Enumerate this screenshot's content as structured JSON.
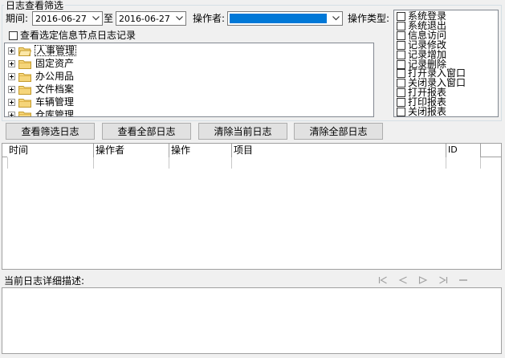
{
  "filter": {
    "group_title": "日志查看筛选",
    "period_label": "期间:",
    "date_from": "2016-06-27",
    "to_label": "至",
    "date_to": "2016-06-27",
    "operator_label": "操作者:",
    "operator_value": "",
    "type_label": "操作类型:",
    "node_log_checkbox_label": "查看选定信息节点日志记录",
    "node_log_checked": false
  },
  "tree": {
    "items": [
      {
        "label": "人事管理",
        "selected": true
      },
      {
        "label": "固定资产"
      },
      {
        "label": "办公用品"
      },
      {
        "label": "文件档案"
      },
      {
        "label": "车辆管理"
      },
      {
        "label": "仓库管理"
      }
    ]
  },
  "operation_types": [
    {
      "label": "系统登录",
      "checked": false
    },
    {
      "label": "系统退出",
      "checked": false
    },
    {
      "label": "信息访问",
      "checked": false
    },
    {
      "label": "记录修改",
      "checked": false
    },
    {
      "label": "记录增加",
      "checked": false
    },
    {
      "label": "记录删除",
      "checked": false
    },
    {
      "label": "打开录入窗口",
      "checked": false
    },
    {
      "label": "关闭录入窗口",
      "checked": false
    },
    {
      "label": "打开报表",
      "checked": false
    },
    {
      "label": "打印报表",
      "checked": false
    },
    {
      "label": "关闭报表",
      "checked": false
    }
  ],
  "buttons": {
    "view_filtered": "查看筛选日志",
    "view_all": "查看全部日志",
    "clear_current": "清除当前日志",
    "clear_all": "清除全部日志"
  },
  "log_table": {
    "columns": [
      "时间",
      "操作者",
      "操作",
      "项目",
      "ID"
    ],
    "rows": []
  },
  "detail": {
    "label": "当前日志详细描述:",
    "text": ""
  },
  "nav_icons": [
    "first-icon",
    "prev-icon",
    "next-icon",
    "last-icon",
    "clear-icon"
  ],
  "colors": {
    "selection": "#0078d7",
    "window_bg": "#f0f0f0"
  }
}
